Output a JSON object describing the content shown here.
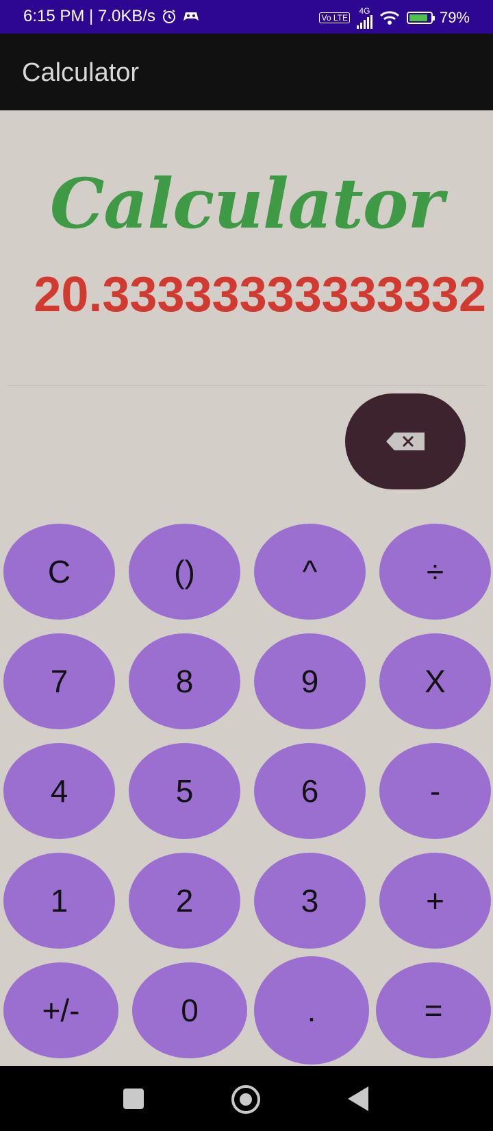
{
  "status_bar": {
    "time_speed": "6:15 PM | 7.0KB/s",
    "volte": "Vo LTE",
    "network": "4G",
    "battery": "79%"
  },
  "app_bar": {
    "title": "Calculator"
  },
  "heading": "Calculator",
  "display": {
    "result": "20.33333333333332"
  },
  "keys": {
    "clear": "C",
    "parentheses": "()",
    "power": "^",
    "divide": "÷",
    "seven": "7",
    "eight": "8",
    "nine": "9",
    "multiply": "X",
    "four": "4",
    "five": "5",
    "six": "6",
    "minus": "-",
    "one": "1",
    "two": "2",
    "three": "3",
    "plus": "+",
    "negate": "+/-",
    "zero": "0",
    "decimal": ".",
    "equals": "="
  },
  "colors": {
    "status_bar": "#2d0691",
    "app_bar": "#111111",
    "background": "#d3cec8",
    "heading": "#3f9a45",
    "result": "#d13a30",
    "key": "#9a6fd0",
    "backspace": "#3c232d"
  },
  "icons": {
    "status": [
      "alarm-icon",
      "game-icon",
      "signal-icon",
      "wifi-icon",
      "battery-icon"
    ],
    "backspace": "backspace-icon",
    "nav": [
      "recents-icon",
      "home-icon",
      "back-icon"
    ]
  }
}
